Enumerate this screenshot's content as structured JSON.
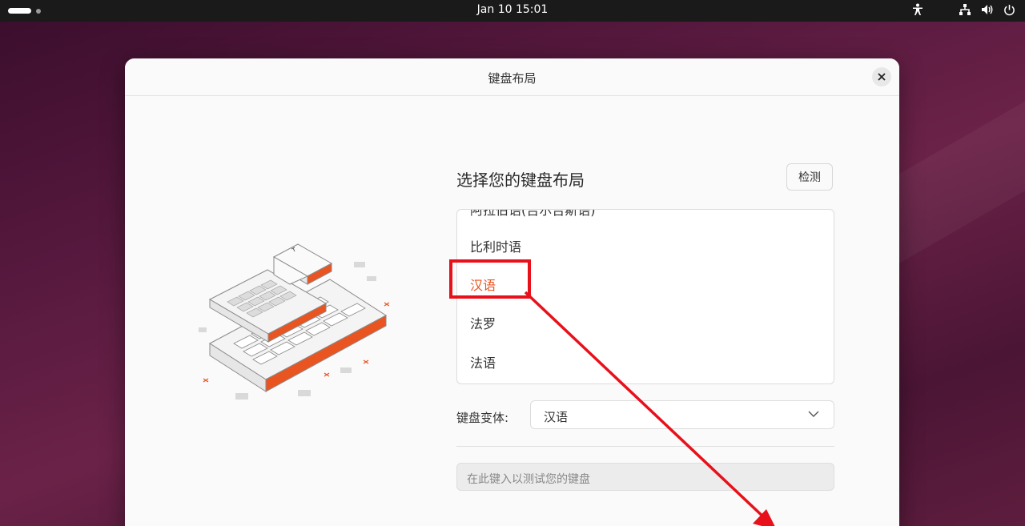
{
  "topbar": {
    "clock": "Jan 10  15:01",
    "icons": [
      "activities-indicator",
      "accessibility-icon",
      "network-icon",
      "volume-icon",
      "power-icon"
    ]
  },
  "dialog": {
    "title": "键盘布局",
    "heading": "选择您的键盘布局",
    "detect_label": "检测",
    "layouts": [
      "阿拉伯语(吉尔吉斯语)",
      "比利时语",
      "汉语",
      "法罗",
      "法语"
    ],
    "selected_layout": "汉语",
    "variant_label": "键盘变体:",
    "variant_value": "汉语",
    "test_placeholder": "在此键入以测试您的键盘"
  },
  "colors": {
    "accent": "#e95420",
    "annotation": "#e8101a",
    "topbar": "#1a1a1a"
  }
}
